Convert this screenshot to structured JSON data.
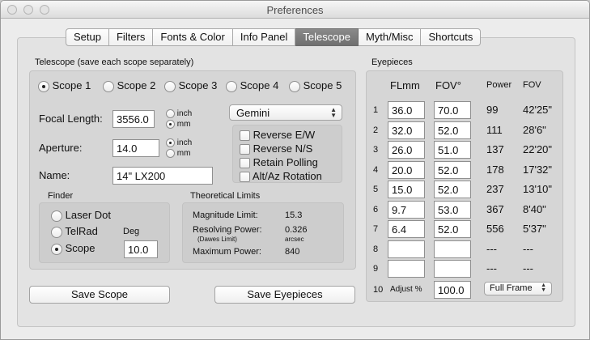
{
  "window": {
    "title": "Preferences"
  },
  "tabs": [
    "Setup",
    "Filters",
    "Fonts & Color",
    "Info Panel",
    "Telescope",
    "Myth/Misc",
    "Shortcuts"
  ],
  "active_tab": "Telescope",
  "telescope": {
    "section_label": "Telescope (save each scope separately)",
    "scopes": [
      "Scope 1",
      "Scope 2",
      "Scope 3",
      "Scope 4",
      "Scope 5"
    ],
    "selected_scope": "Scope 1",
    "focal_length_label": "Focal Length:",
    "focal_length_value": "3556.0",
    "aperture_label": "Aperture:",
    "aperture_value": "14.0",
    "name_label": "Name:",
    "name_value": "14\" LX200",
    "unit_inch": "inch",
    "unit_mm": "mm",
    "focal_unit_selected": "mm",
    "aperture_unit_selected": "inch",
    "mount_select": "Gemini",
    "options": [
      "Reverse E/W",
      "Reverse N/S",
      "Retain Polling",
      "Alt/Az Rotation"
    ]
  },
  "finder": {
    "label": "Finder",
    "options": [
      "Laser Dot",
      "TelRad",
      "Scope"
    ],
    "selected": "Scope",
    "deg_label": "Deg",
    "deg_value": "10.0"
  },
  "limits": {
    "label": "Theoretical Limits",
    "magnitude_label": "Magnitude Limit:",
    "magnitude_value": "15.3",
    "resolving_label": "Resolving Power:",
    "resolving_sub": "(Dawes Limit)",
    "resolving_value": "0.326",
    "resolving_unit": "arcsec",
    "max_power_label": "Maximum Power:",
    "max_power_value": "840"
  },
  "eyepieces": {
    "label": "Eyepieces",
    "col_flmm": "FLmm",
    "col_fov": "FOV°",
    "col_power": "Power",
    "col_fov2": "FOV",
    "rows": [
      {
        "n": "1",
        "fl": "36.0",
        "fov": "70.0",
        "power": "99",
        "fov_out": "42'25\""
      },
      {
        "n": "2",
        "fl": "32.0",
        "fov": "52.0",
        "power": "111",
        "fov_out": "28'6\""
      },
      {
        "n": "3",
        "fl": "26.0",
        "fov": "51.0",
        "power": "137",
        "fov_out": "22'20\""
      },
      {
        "n": "4",
        "fl": "20.0",
        "fov": "52.0",
        "power": "178",
        "fov_out": "17'32\""
      },
      {
        "n": "5",
        "fl": "15.0",
        "fov": "52.0",
        "power": "237",
        "fov_out": "13'10\""
      },
      {
        "n": "6",
        "fl": "9.7",
        "fov": "53.0",
        "power": "367",
        "fov_out": "8'40\""
      },
      {
        "n": "7",
        "fl": "6.4",
        "fov": "52.0",
        "power": "556",
        "fov_out": "5'37\""
      },
      {
        "n": "8",
        "fl": "",
        "fov": "",
        "power": "---",
        "fov_out": "---"
      },
      {
        "n": "9",
        "fl": "",
        "fov": "",
        "power": "---",
        "fov_out": "---"
      }
    ],
    "adjust_row_n": "10",
    "adjust_label": "Adjust %",
    "adjust_value": "100.0",
    "frame_select": "Full Frame"
  },
  "buttons": {
    "save_scope": "Save Scope",
    "save_eyepieces": "Save Eyepieces"
  },
  "colors": {
    "active_tab": "#7a7a7a",
    "window_bg": "#ececec"
  }
}
